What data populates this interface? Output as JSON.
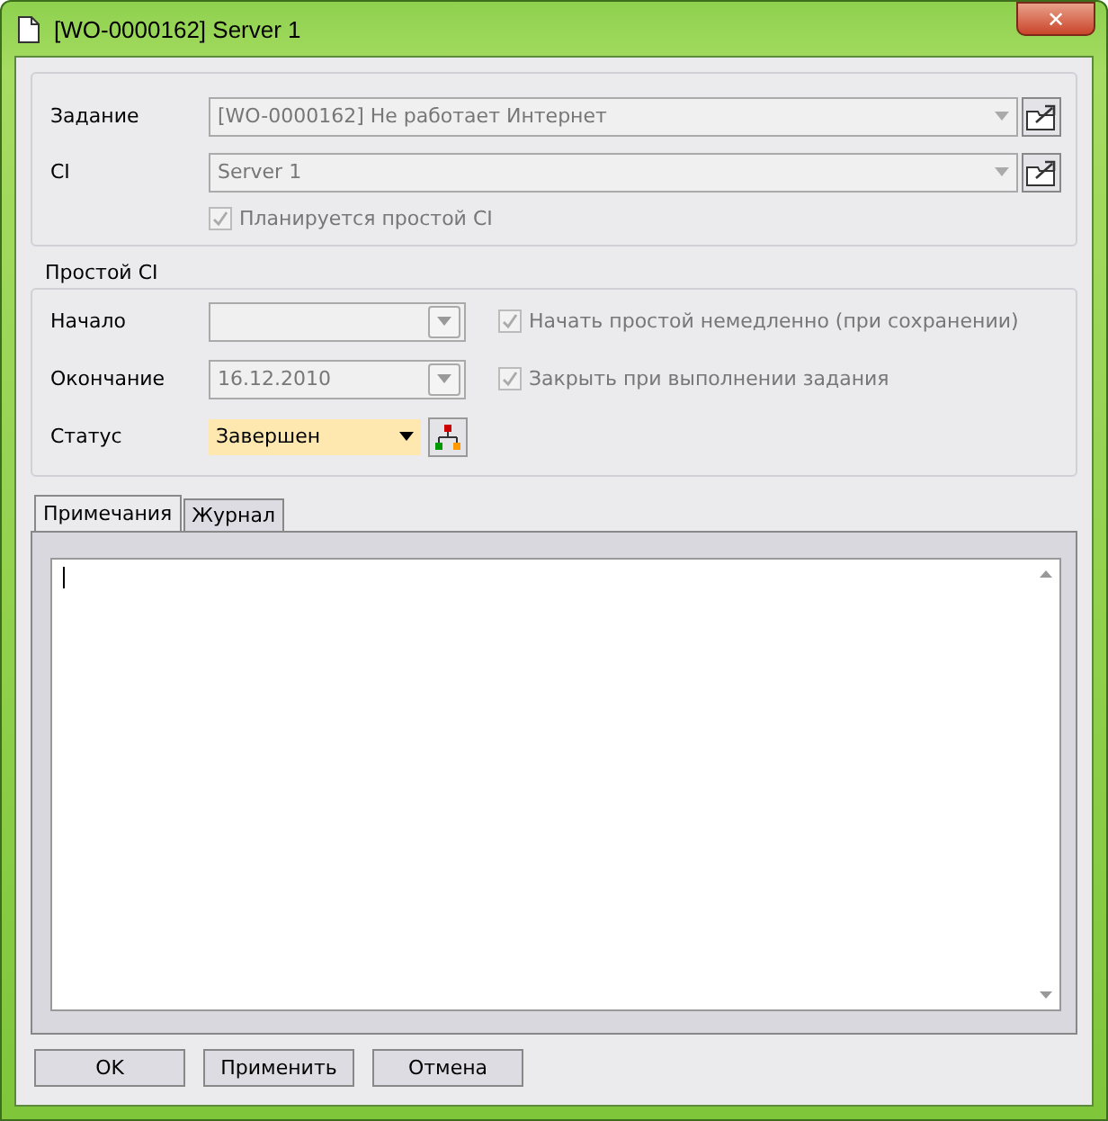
{
  "window": {
    "title": "[WO-0000162] Server 1",
    "close": "✕"
  },
  "main_fields": [
    {
      "label": "Задание",
      "value": "[WO-0000162] Не работает Интернет",
      "disabled": true
    },
    {
      "label": "CI",
      "value": "Server 1",
      "disabled": true
    }
  ],
  "planned_downtime": {
    "label": "Планируется простой CI",
    "checked": true,
    "disabled": true
  },
  "downtime_group": {
    "title": "Простой CI",
    "start": {
      "label": "Начало",
      "disabled": true
    },
    "end": {
      "label": "Окончание",
      "value": "16.12.2010",
      "disabled": true
    },
    "start_now": {
      "label": "Начать простой немедленно (при сохранении)",
      "checked": true,
      "disabled": true
    },
    "close_on_done": {
      "label": "Закрыть при выполнении задания",
      "checked": true,
      "disabled": true
    },
    "status": {
      "label": "Статус",
      "value": "Завершен"
    }
  },
  "tabs": [
    {
      "label": "Примечания",
      "selected": true
    },
    {
      "label": "Журнал",
      "selected": false
    }
  ],
  "buttons": [
    "OK",
    "Применить",
    "Отмена"
  ]
}
